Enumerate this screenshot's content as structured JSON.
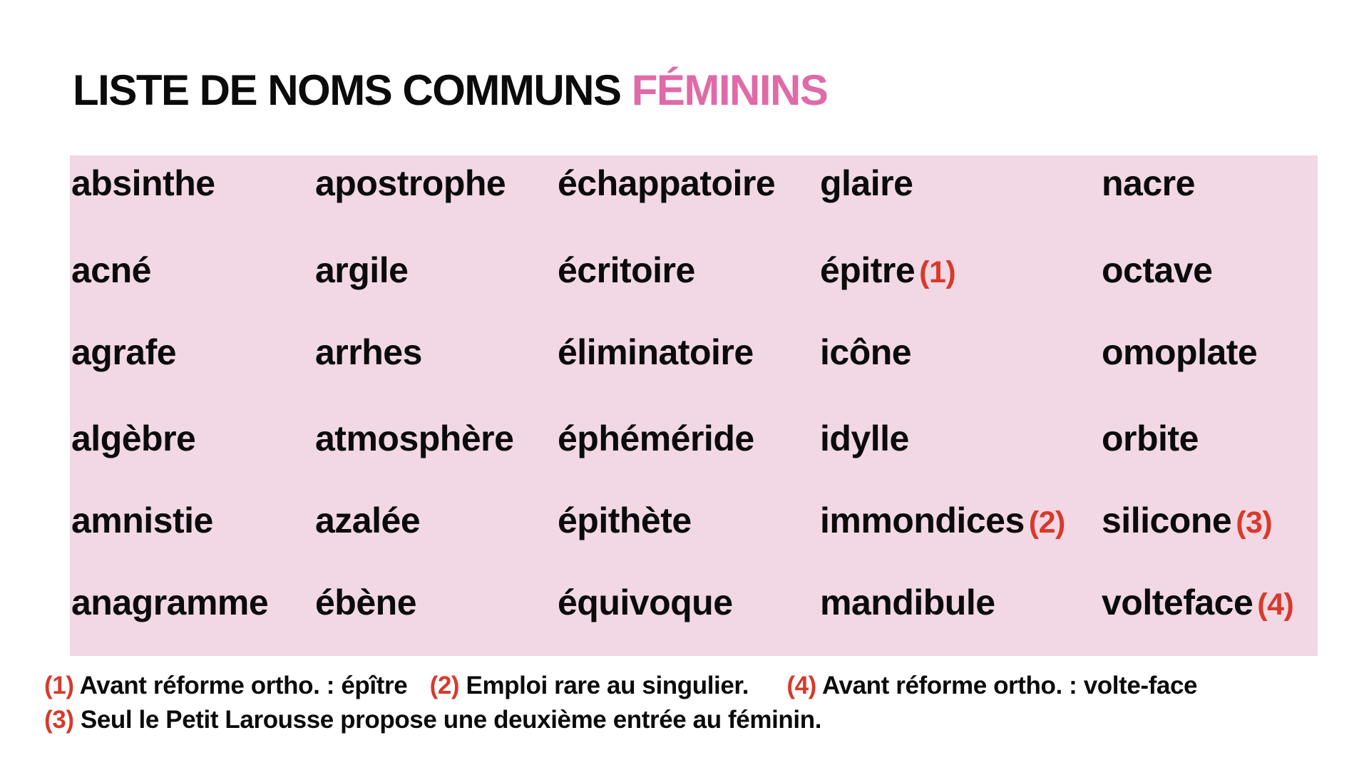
{
  "title": {
    "main": "LISTE DE NOMS COMMUNS ",
    "accent": "FÉMININS"
  },
  "colors": {
    "accent_pink": "#e06aa8",
    "panel_background": "#f1d8e4",
    "footnote_red": "#d9392b",
    "text": "#0b0b0b"
  },
  "columns": [
    [
      {
        "word": "absinthe",
        "mark": ""
      },
      {
        "word": "acné",
        "mark": ""
      },
      {
        "word": "agrafe",
        "mark": ""
      },
      {
        "word": "algèbre",
        "mark": ""
      },
      {
        "word": "amnistie",
        "mark": ""
      },
      {
        "word": "anagramme",
        "mark": ""
      }
    ],
    [
      {
        "word": "apostrophe",
        "mark": ""
      },
      {
        "word": "argile",
        "mark": ""
      },
      {
        "word": "arrhes",
        "mark": ""
      },
      {
        "word": "atmosphère",
        "mark": ""
      },
      {
        "word": "azalée",
        "mark": ""
      },
      {
        "word": "ébène",
        "mark": ""
      }
    ],
    [
      {
        "word": "échappatoire",
        "mark": ""
      },
      {
        "word": "écritoire",
        "mark": ""
      },
      {
        "word": "éliminatoire",
        "mark": ""
      },
      {
        "word": "éphéméride",
        "mark": ""
      },
      {
        "word": "épithète",
        "mark": ""
      },
      {
        "word": "équivoque",
        "mark": ""
      }
    ],
    [
      {
        "word": "glaire",
        "mark": ""
      },
      {
        "word": "épitre",
        "mark": "(1)"
      },
      {
        "word": "icône",
        "mark": ""
      },
      {
        "word": "idylle",
        "mark": ""
      },
      {
        "word": "immondices",
        "mark": "(2)"
      },
      {
        "word": "mandibule",
        "mark": ""
      }
    ],
    [
      {
        "word": "nacre",
        "mark": ""
      },
      {
        "word": "octave",
        "mark": ""
      },
      {
        "word": "omoplate",
        "mark": ""
      },
      {
        "word": "orbite",
        "mark": ""
      },
      {
        "word": "silicone",
        "mark": "(3)"
      },
      {
        "word": "volteface",
        "mark": "(4)"
      }
    ]
  ],
  "footnotes": {
    "n1": {
      "mark": "(1)",
      "text": " Avant réforme ortho. : épître"
    },
    "n2": {
      "mark": "(2)",
      "text": " Emploi rare au singulier."
    },
    "n4": {
      "mark": "(4)",
      "text": " Avant réforme ortho. : volte-face"
    },
    "n3": {
      "mark": "(3)",
      "text": " Seul le Petit Larousse propose une deuxième entrée au féminin."
    }
  }
}
